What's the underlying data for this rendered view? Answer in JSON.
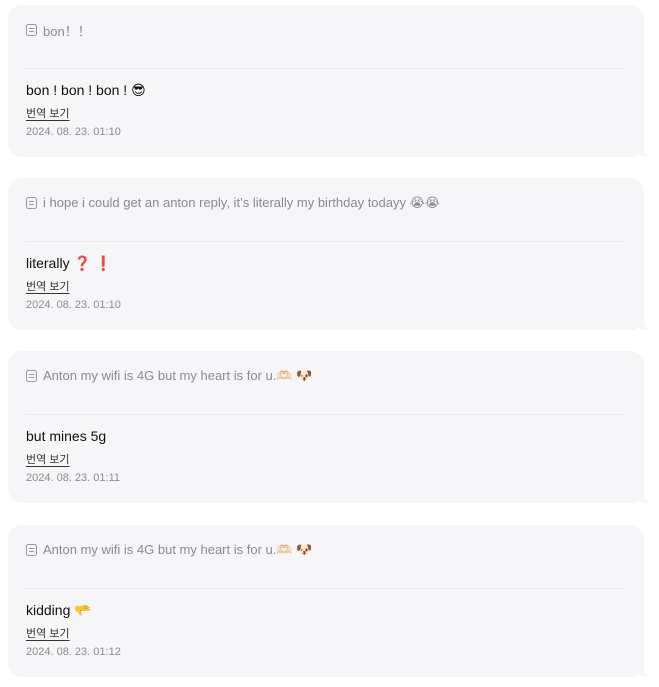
{
  "messages": [
    {
      "quote": "bon！！",
      "reply": "bon ! bon ! bon ! 😎",
      "translate_label": "번역 보기",
      "timestamp": "2024. 08. 23. 01:10"
    },
    {
      "quote": "i hope i could get an anton reply, it’s literally my birthday todayy 😭😭",
      "reply": "literally ❓ ❗",
      "translate_label": "번역 보기",
      "timestamp": "2024. 08. 23. 01:10"
    },
    {
      "quote": "Anton my wifi is 4G but my heart is for u.🫶🏻 🐶",
      "reply": "but mines 5g",
      "translate_label": "번역 보기",
      "timestamp": "2024. 08. 23. 01:11"
    },
    {
      "quote": "Anton my wifi is 4G but my heart is for u.🫶🏻 🐶",
      "reply": "kidding 🫳",
      "translate_label": "번역 보기",
      "timestamp": "2024. 08. 23. 01:12"
    }
  ]
}
